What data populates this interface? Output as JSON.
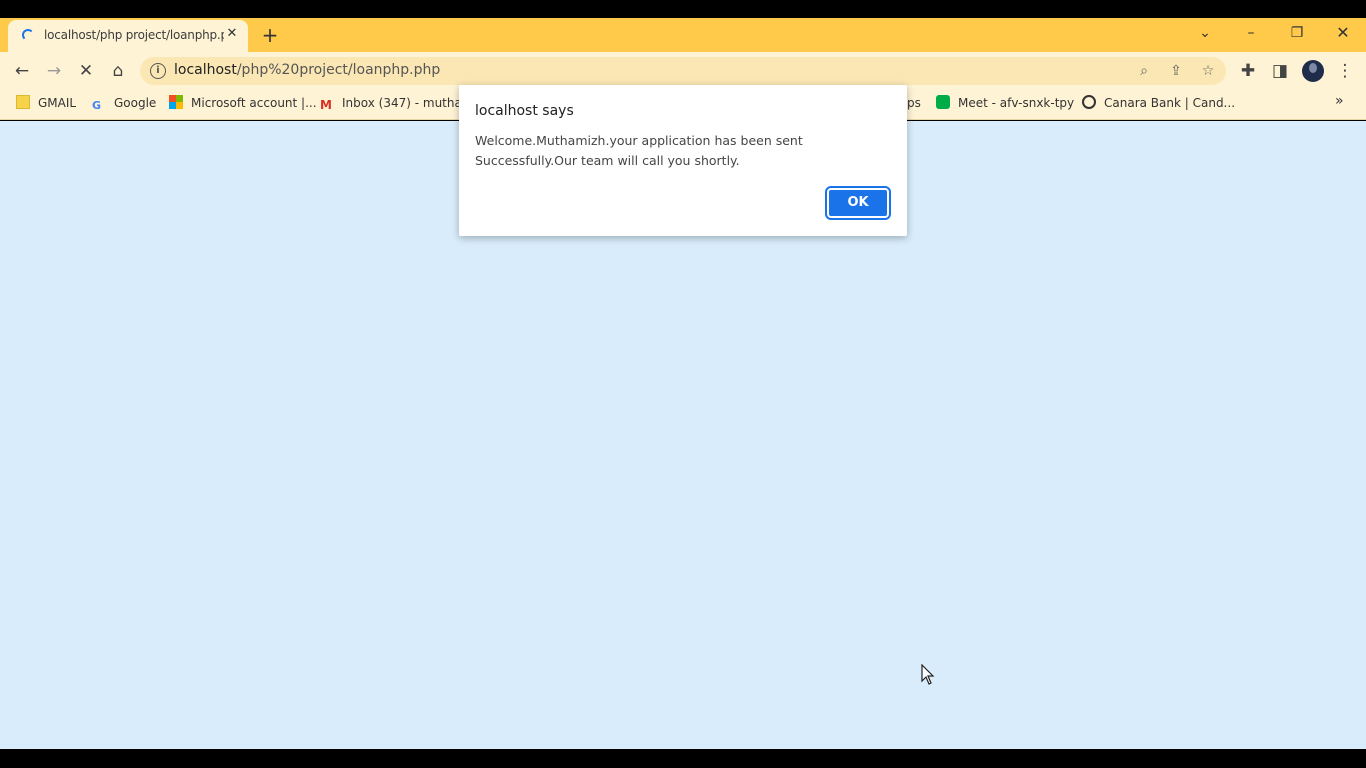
{
  "tab": {
    "title": "localhost/php project/loanphp.p"
  },
  "omnibox": {
    "host": "localhost",
    "path": "/php%20project/loanphp.php"
  },
  "bookmarks": [
    {
      "label": "GMAIL",
      "icon": "folder-icon"
    },
    {
      "label": "Google",
      "icon": "google-icon"
    },
    {
      "label": "Microsoft account |...",
      "icon": "microsoft-icon"
    },
    {
      "label": "Inbox (347) - mutha...",
      "icon": "gmail-icon"
    },
    {
      "label": "ps",
      "icon": ""
    },
    {
      "label": "Meet - afv-snxk-tpy",
      "icon": "meet-icon"
    },
    {
      "label": "Canara Bank | Cand...",
      "icon": "globe-icon"
    }
  ],
  "dialog": {
    "title": "localhost says",
    "message": "Welcome.Muthamizh.your application has been sent Successfully.Our team will call you shortly.",
    "ok_label": "OK"
  },
  "colors": {
    "tabstrip": "#ffc94a",
    "toolbar": "#fff3d6",
    "page_bg": "#d8ecfb",
    "accent": "#1a73e8"
  }
}
